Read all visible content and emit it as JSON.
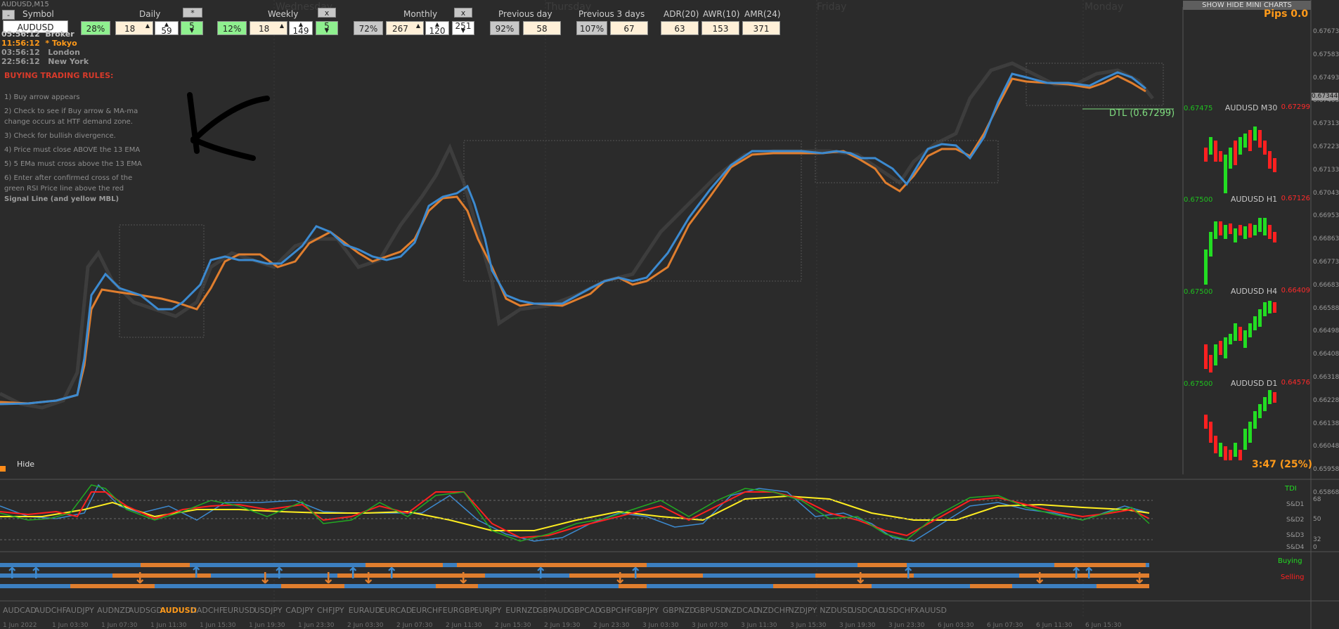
{
  "window_title": "AUDUSD,M15",
  "panel": {
    "minus_btn": "-",
    "symbol_label": "Symbol",
    "symbol_value": "AUDUSD",
    "daily": {
      "label": "Daily",
      "close_btn": "*",
      "pct": "28%",
      "v1": "18",
      "v2": "59",
      "v3": "5"
    },
    "weekly": {
      "label": "Weekly",
      "close_btn": "x",
      "pct": "12%",
      "v1": "18",
      "v2": "149",
      "v3": "5"
    },
    "monthly": {
      "label": "Monthly",
      "close_btn": "x",
      "pct": "72%",
      "v1": "267",
      "v2": "120",
      "v3": "251"
    },
    "prev_day": {
      "label": "Previous day",
      "pct": "92%",
      "v": "58"
    },
    "prev_3": {
      "label": "Previous 3 days",
      "pct": "107%",
      "v": "67"
    },
    "adr": {
      "label": "ADR(20)",
      "v": "63"
    },
    "awr": {
      "label": "AWR(10)",
      "v": "153"
    },
    "amr": {
      "label": "AMR(24)",
      "v": "371"
    }
  },
  "sessions": [
    {
      "time": "05:56:12",
      "name": "Broker",
      "color": "#c8c8c8"
    },
    {
      "time": "11:56:12",
      "name": "* Tokyo",
      "color": "#ff9a1a"
    },
    {
      "time": "03:56:12",
      "name": "London",
      "color": "#9a9a9a"
    },
    {
      "time": "22:56:12",
      "name": "New York",
      "color": "#9a9a9a"
    }
  ],
  "rules": {
    "title": "BUYING TRADING RULES:",
    "lines": [
      "1) Buy arrow appears",
      "2) Check to see if Buy arrow & MA-ma",
      "change occurs at HTF demand zone.",
      "3) Check for bullish divergence.",
      "4) Price must close ABOVE the 13 EMA",
      "5) 5 EMa must cross above the 13 EMA",
      "6) Enter after confirmed cross of the",
      "green RSI Price line above the red",
      "Signal Line (and yellow MBL)"
    ]
  },
  "day_labels": [
    "Wednesday",
    "Thursday",
    "Friday",
    "Monday"
  ],
  "hide_label": "Hide",
  "show_hide_mini": "SHOW HIDE MINI CHARTS",
  "pips": "Pips 0.0",
  "dtl_label": "DTL (0.67299)",
  "countdown": "3:47 (25%)",
  "mini_charts": [
    {
      "title": "AUDUSD M30",
      "left": "0.67475",
      "right": "0.67299"
    },
    {
      "title": "AUDUSD H1",
      "left": "0.67500",
      "right": "0.67126"
    },
    {
      "title": "AUDUSD H4",
      "left": "0.67500",
      "right": "0.66409"
    },
    {
      "title": "AUDUSD D1",
      "left": "0.67500",
      "right": "0.64576"
    }
  ],
  "price_axis": [
    "0.67673",
    "0.67583",
    "0.67493",
    "0.67403",
    "0.67313",
    "0.67223",
    "0.67133",
    "0.67043",
    "0.66953",
    "0.66863",
    "0.66773",
    "0.66683",
    "0.66588",
    "0.66498",
    "0.66408",
    "0.66318",
    "0.66228",
    "0.66138",
    "0.66048",
    "0.65958",
    "0.65868"
  ],
  "price_current": "0.67344",
  "tdi": {
    "label": "TDI",
    "levels": [
      "68",
      "S&D1",
      "50",
      "S&D2",
      "32",
      "S&D3",
      "S&D4",
      "0"
    ]
  },
  "signals": {
    "buying": "Buying",
    "selling": "Selling"
  },
  "symbols": [
    "AUDCAD",
    "AUDCHF",
    "AUDJPY",
    "AUDNZD",
    "AUDSGD",
    "AUDUSD",
    "CADCHF",
    "EURUSD",
    "USDJPY",
    "CADJPY",
    "CHFJPY",
    "EURAUD",
    "EURCAD",
    "EURCHF",
    "EURGBP",
    "EURJPY",
    "EURNZD",
    "GBPAUD",
    "GBPCAD",
    "GBPCHF",
    "GBPJPY",
    "GBPNZD",
    "GBPUSD",
    "NZDCAD",
    "NZDCHF",
    "NZDJPY",
    "NZDUSD",
    "USDCAD",
    "USDCHF",
    "XAUUSD"
  ],
  "active_symbol": "AUDUSD",
  "time_axis": [
    "1 Jun 2022",
    "1 Jun 03:30",
    "1 Jun 07:30",
    "1 Jun 11:30",
    "1 Jun 15:30",
    "1 Jun 19:30",
    "1 Jun 23:30",
    "2 Jun 03:30",
    "2 Jun 07:30",
    "2 Jun 11:30",
    "2 Jun 15:30",
    "2 Jun 19:30",
    "2 Jun 23:30",
    "3 Jun 03:30",
    "3 Jun 07:30",
    "3 Jun 11:30",
    "3 Jun 15:30",
    "3 Jun 19:30",
    "3 Jun 23:30",
    "6 Jun 03:30",
    "6 Jun 07:30",
    "6 Jun 11:30",
    "6 Jun 15:30"
  ]
}
